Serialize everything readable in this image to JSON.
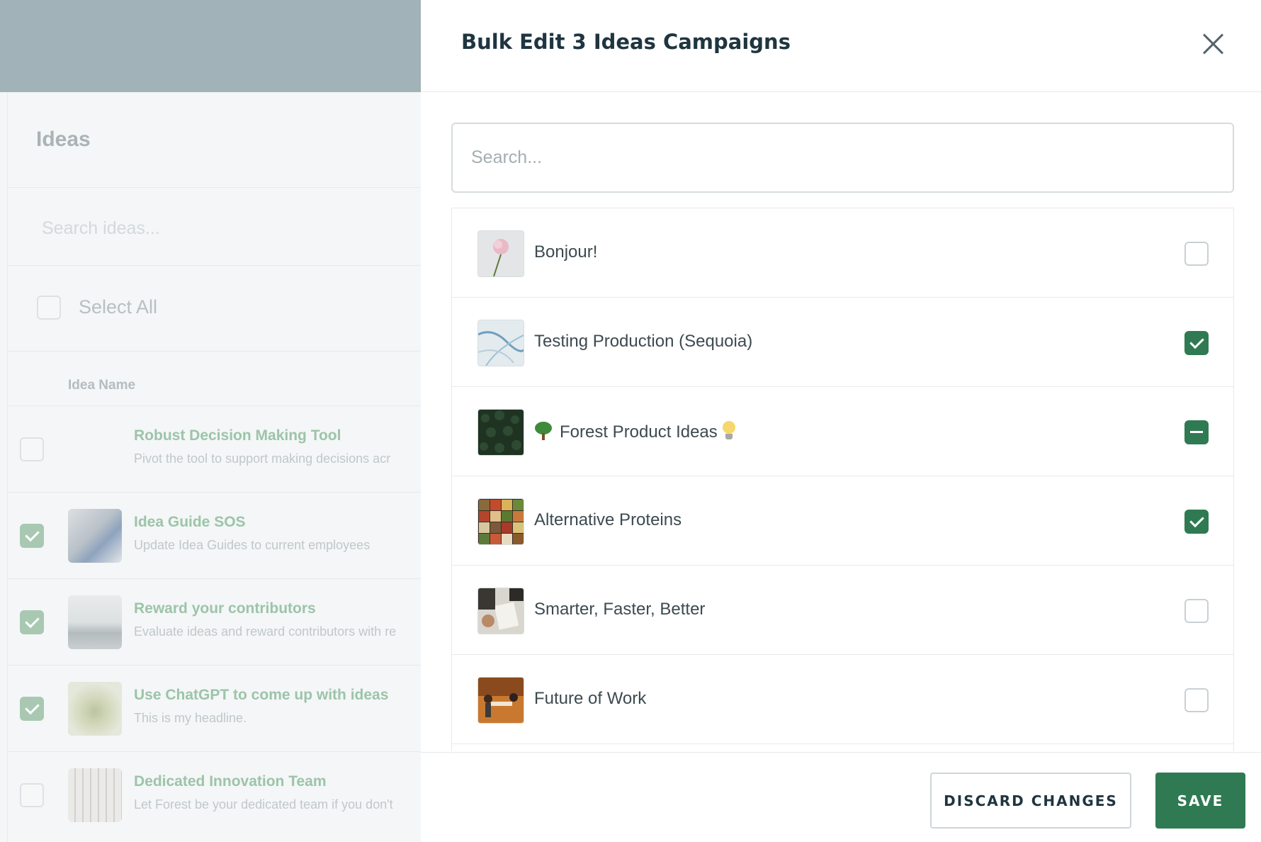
{
  "background": {
    "title": "Ideas",
    "search_placeholder": "Search ideas...",
    "select_all_label": "Select All",
    "column_header": "Idea Name",
    "ideas": [
      {
        "title": "Robust Decision Making Tool",
        "subtitle": "Pivot the tool to support making decisions acr",
        "checked": false,
        "thumbnail": "none"
      },
      {
        "title": "Idea Guide SOS",
        "subtitle": "Update Idea Guides to current employees",
        "checked": true,
        "thumbnail": "booklet-photo"
      },
      {
        "title": "Reward your contributors",
        "subtitle": "Evaluate ideas and reward contributors with re",
        "checked": true,
        "thumbnail": "lake-photo"
      },
      {
        "title": "Use ChatGPT to come up with ideas",
        "subtitle": "This is my headline.",
        "checked": true,
        "thumbnail": "grasshopper-photo"
      },
      {
        "title": "Dedicated Innovation Team",
        "subtitle": "Let Forest be your dedicated team if you don't",
        "checked": false,
        "thumbnail": "figures-photo"
      }
    ]
  },
  "modal": {
    "title": "Bulk Edit 3 Ideas Campaigns",
    "close_icon": "close-icon",
    "search_placeholder": "Search...",
    "search_value": "",
    "campaigns": [
      {
        "name": "Bonjour!",
        "state": "unchecked",
        "thumbnail": "flower-photo"
      },
      {
        "name": "Testing Production (Sequoia)",
        "state": "checked",
        "thumbnail": "marble-photo"
      },
      {
        "name": "Forest Product Ideas",
        "state": "partial",
        "thumbnail": "forest-photo",
        "prefix_icon": "tree-emoji",
        "suffix_icon": "lightbulb-emoji"
      },
      {
        "name": "Alternative Proteins",
        "state": "checked",
        "thumbnail": "produce-grid-photo"
      },
      {
        "name": "Smarter, Faster, Better",
        "state": "unchecked",
        "thumbnail": "desk-work-photo"
      },
      {
        "name": "Future of Work",
        "state": "unchecked",
        "thumbnail": "office-photo"
      }
    ],
    "footer": {
      "discard_label": "DISCARD CHANGES",
      "save_label": "SAVE"
    }
  },
  "colors": {
    "accent": "#2f7a52",
    "title_text": "#1f3540",
    "overlay": "#a1b3b8"
  }
}
